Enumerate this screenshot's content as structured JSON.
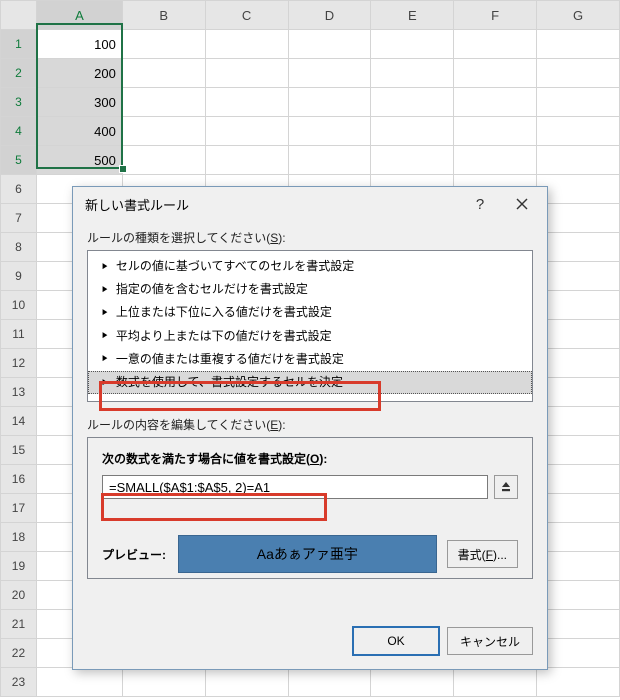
{
  "grid": {
    "col_headers": [
      "A",
      "B",
      "C",
      "D",
      "E",
      "F",
      "G"
    ],
    "row_headers": [
      "1",
      "2",
      "3",
      "4",
      "5",
      "6",
      "7",
      "8",
      "9",
      "10",
      "11",
      "12",
      "13",
      "14",
      "15",
      "16",
      "17",
      "18",
      "19",
      "20",
      "21",
      "22",
      "23"
    ],
    "selected_rows": [
      0,
      1,
      2,
      3,
      4
    ],
    "selected_col": 0,
    "values_colA": [
      "100",
      "200",
      "300",
      "400",
      "500"
    ]
  },
  "dialog": {
    "title": "新しい書式ルール",
    "help_glyph": "?",
    "section_rule_type": "ルールの種類を選択してください(",
    "section_rule_type_accel": "S",
    "section_rule_type_suffix": "):",
    "rule_types": [
      "セルの値に基づいてすべてのセルを書式設定",
      "指定の値を含むセルだけを書式設定",
      "上位または下位に入る値だけを書式設定",
      "平均より上または下の値だけを書式設定",
      "一意の値または重複する値だけを書式設定",
      "数式を使用して、書式設定するセルを決定"
    ],
    "selected_rule_type_index": 5,
    "section_edit": "ルールの内容を編集してください(",
    "section_edit_accel": "E",
    "section_edit_suffix": "):",
    "panel_title": "次の数式を満たす場合に値を書式設定(",
    "panel_title_accel": "O",
    "panel_title_suffix": "):",
    "formula": "=SMALL($A$1:$A$5, 2)=A1",
    "preview_label": "プレビュー:",
    "preview_text": "Aaあぁアァ亜宇",
    "format_btn_prefix": "書式(",
    "format_btn_accel": "F",
    "format_btn_suffix": ")...",
    "ok": "OK",
    "cancel": "キャンセル"
  }
}
